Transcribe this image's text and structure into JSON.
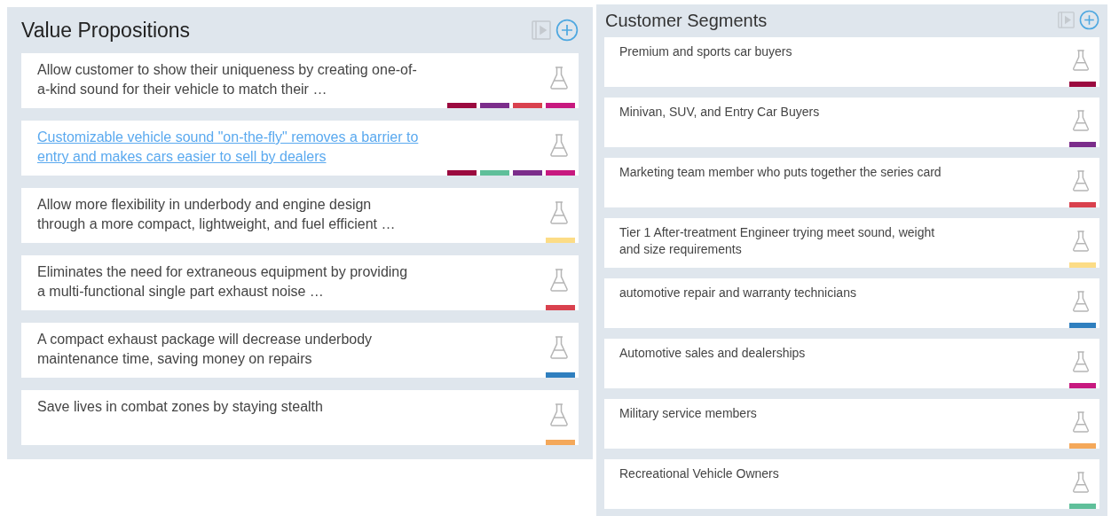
{
  "panels": [
    {
      "title": "Value Propositions",
      "kind": "main",
      "cards": [
        {
          "text": "Allow customer to show their uniqueness by creating one-of-a-kind sound for their vehicle to match their …",
          "link": false,
          "tags": [
            {
              "color": "#9b0a3f"
            },
            {
              "color": "#7b2d8b"
            },
            {
              "color": "#d9414e"
            },
            {
              "color": "#c7197f"
            }
          ]
        },
        {
          "text": "Customizable vehicle sound \"on-the-fly\" removes a barrier to entry and makes cars easier to sell by dealers",
          "link": true,
          "tags": [
            {
              "color": "#9b0a3f"
            },
            {
              "color": "#5fbf9a"
            },
            {
              "color": "#7b2d8b"
            },
            {
              "color": "#c7197f"
            }
          ]
        },
        {
          "text": "Allow more flexibility in underbody and engine design through a more compact, lightweight, and fuel efficient …",
          "link": false,
          "tags": [
            {
              "color": "#fcdc86"
            }
          ]
        },
        {
          "text": "Eliminates the need for extraneous equipment by providing a multi-functional single part exhaust noise …",
          "link": false,
          "tags": [
            {
              "color": "#d9414e"
            }
          ]
        },
        {
          "text": "A compact exhaust package will decrease underbody maintenance time, saving money on repairs",
          "link": false,
          "tags": [
            {
              "color": "#2f7fbf"
            }
          ]
        },
        {
          "text": "Save lives in combat zones by staying stealth",
          "link": false,
          "tags": [
            {
              "color": "#f4a85a"
            }
          ]
        }
      ]
    },
    {
      "title": "Customer Segments",
      "kind": "side",
      "cards": [
        {
          "text": "Premium and sports car buyers",
          "link": false,
          "tags": [
            {
              "color": "#9b0a3f"
            }
          ]
        },
        {
          "text": "Minivan, SUV, and Entry Car Buyers",
          "link": false,
          "tags": [
            {
              "color": "#7b2d8b"
            }
          ]
        },
        {
          "text": "Marketing team member who puts together the series card",
          "link": false,
          "tags": [
            {
              "color": "#d9414e"
            }
          ]
        },
        {
          "text": "Tier 1 After-treatment Engineer trying meet sound, weight and size requirements",
          "link": false,
          "tags": [
            {
              "color": "#fcdc86"
            }
          ]
        },
        {
          "text": "automotive repair and warranty technicians",
          "link": false,
          "tags": [
            {
              "color": "#2f7fbf"
            }
          ]
        },
        {
          "text": "Automotive sales and dealerships",
          "link": false,
          "tags": [
            {
              "color": "#c7197f"
            }
          ]
        },
        {
          "text": "Military service members",
          "link": false,
          "tags": [
            {
              "color": "#f4a85a"
            }
          ]
        },
        {
          "text": "Recreational Vehicle Owners",
          "link": false,
          "tags": [
            {
              "color": "#5fbf9a"
            }
          ]
        }
      ]
    }
  ]
}
